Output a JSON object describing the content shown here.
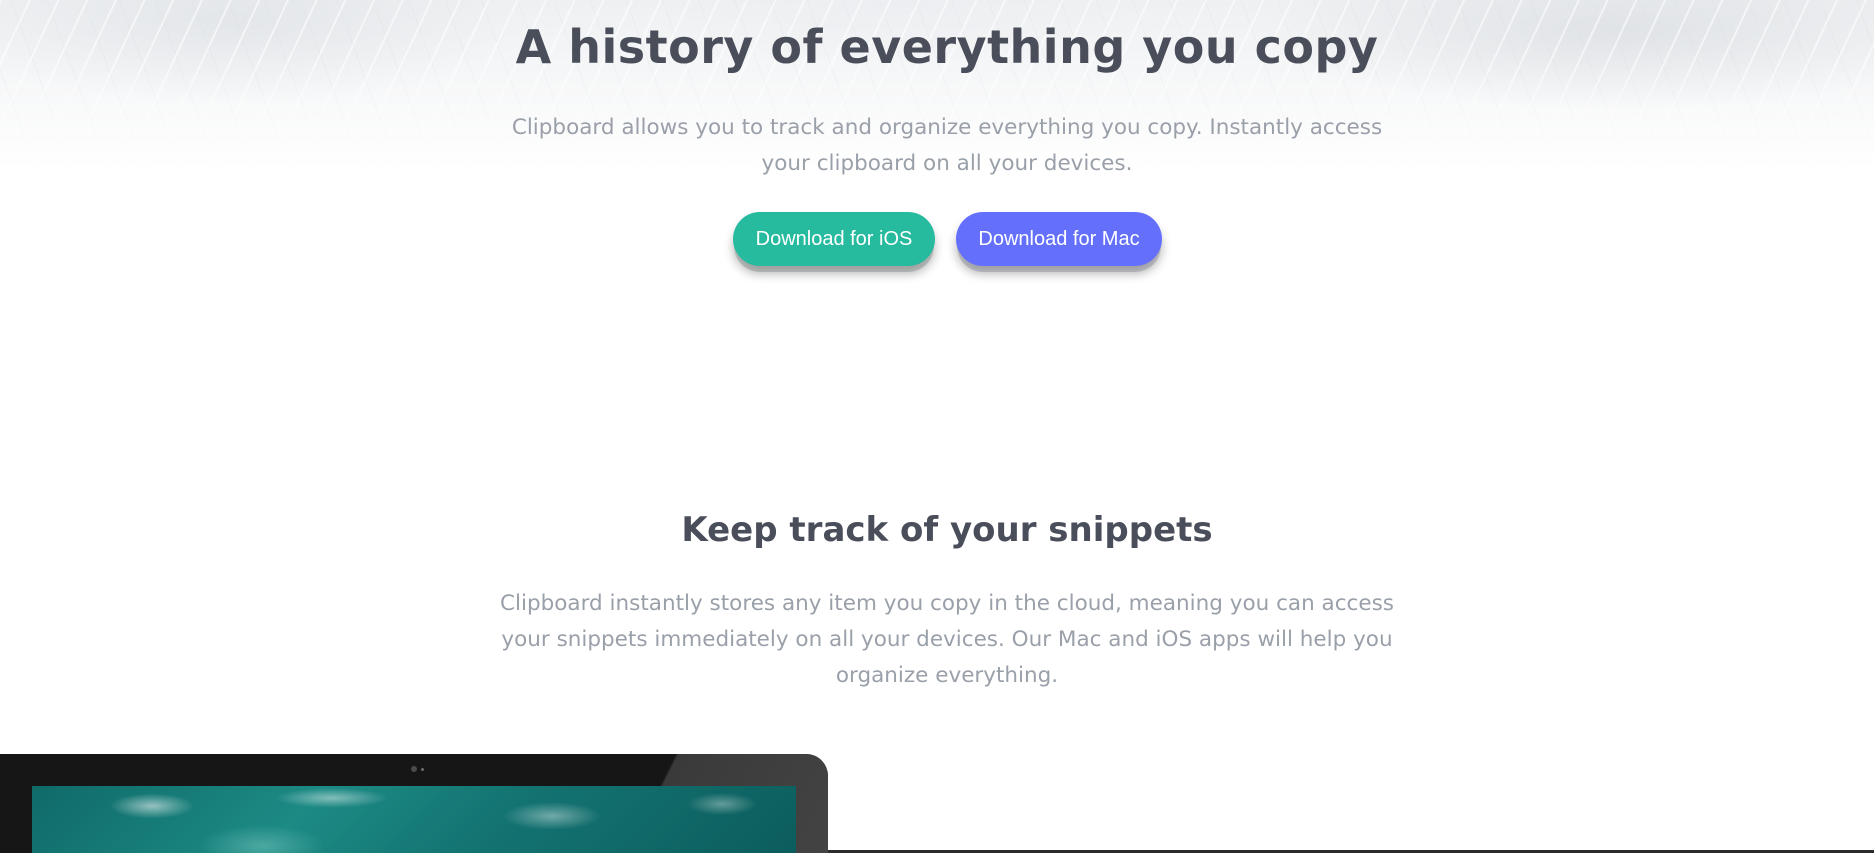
{
  "hero": {
    "title": "A history of everything you copy",
    "text": "Clipboard allows you to track and organize everything you copy. Instantly access your clipboard on all your devices.",
    "ios_button": "Download for iOS",
    "mac_button": "Download for Mac"
  },
  "snippets": {
    "title": "Keep track of your snippets",
    "text": "Clipboard instantly stores any item you copy in the cloud, meaning you can access your snippets immediately on all your devices. Our Mac and iOS apps will help you organize everything."
  },
  "colors": {
    "ios_button": "#26ba9f",
    "mac_button": "#6470fb",
    "heading": "#4a4e5a",
    "body_text": "#9aa0a9"
  },
  "icons": {
    "device_mockup": "imac-mockup"
  }
}
